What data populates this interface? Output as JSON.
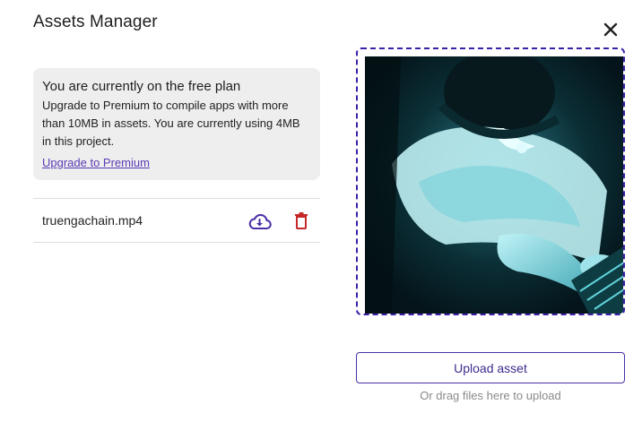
{
  "dialog": {
    "title": "Assets Manager"
  },
  "plan": {
    "heading": "You are currently on the free plan",
    "message": "Upgrade to Premium to compile apps with more than 10MB in assets. You are currently using 4MB in this project.",
    "link_label": "Upgrade to Premium"
  },
  "assets": [
    {
      "name": "truengachain.mp4"
    }
  ],
  "upload": {
    "button_label": "Upload asset",
    "hint": "Or drag files here to upload"
  },
  "colors": {
    "accent": "#4b2fa8",
    "link": "#5b3bb5",
    "delete": "#c62828",
    "panel_bg": "#eeeeee"
  },
  "icons": {
    "close": "close-icon",
    "download": "cloud-download-icon",
    "delete": "trash-icon"
  }
}
